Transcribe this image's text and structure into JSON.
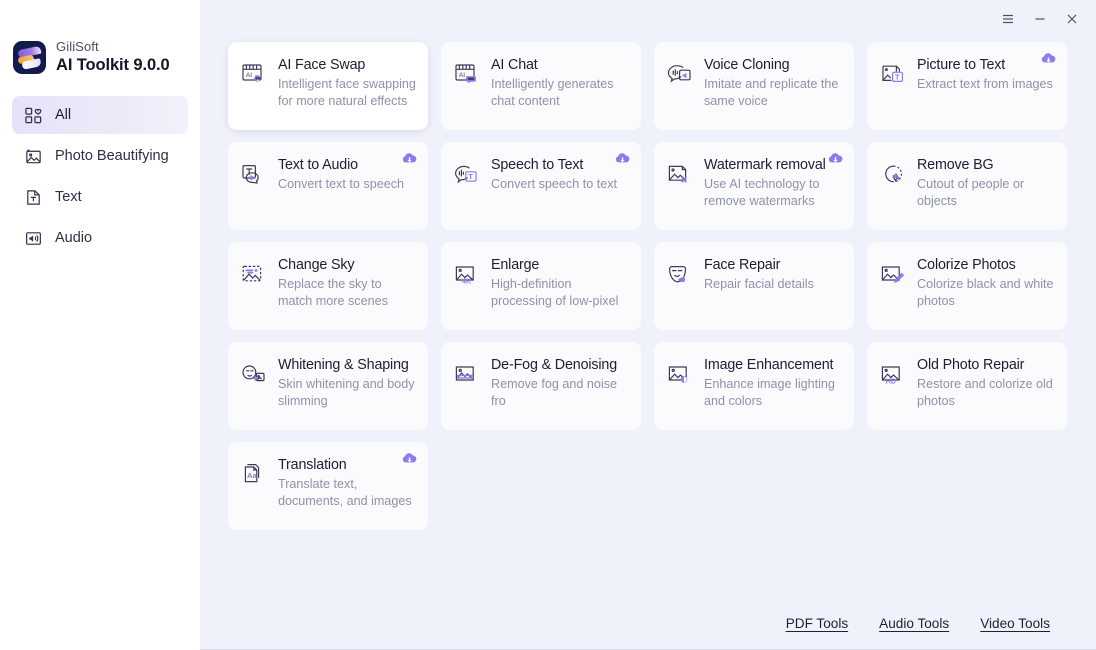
{
  "sidebar": {
    "brand": {
      "vendor": "GiliSoft",
      "product": "AI Toolkit 9.0.0",
      "logo_icon": "gilisoft-logo"
    },
    "items": [
      {
        "label": "All",
        "icon": "grid-heart-icon",
        "active": true
      },
      {
        "label": "Photo Beautifying",
        "icon": "photo-sparkle-icon",
        "active": false
      },
      {
        "label": "Text",
        "icon": "text-document-icon",
        "active": false
      },
      {
        "label": "Audio",
        "icon": "speaker-icon",
        "active": false
      }
    ]
  },
  "titlebar": {
    "buttons": [
      {
        "name": "menu-button",
        "icon": "hamburger-icon"
      },
      {
        "name": "minimize-button",
        "icon": "minimize-icon"
      },
      {
        "name": "close-button",
        "icon": "close-icon"
      }
    ]
  },
  "colors": {
    "accent": "#8b7bec",
    "main_background": "#f0f2fb",
    "card_background": "#fbfbfe",
    "sidebar_background": "#ffffff",
    "title_text": "#1c1e33",
    "desc_text": "#8e92a8",
    "logo_background": "#131a4f"
  },
  "cards": [
    {
      "title": "AI Face Swap",
      "desc": "Intelligent face swapping for more natural effects",
      "icon": "ai-face-swap-icon",
      "cloud": false,
      "hover": true
    },
    {
      "title": "AI Chat",
      "desc": "Intelligently generates chat content",
      "icon": "ai-chat-icon",
      "cloud": false,
      "hover": false
    },
    {
      "title": "Voice Cloning",
      "desc": "Imitate and replicate the same voice",
      "icon": "voice-cloning-icon",
      "cloud": false,
      "hover": false
    },
    {
      "title": "Picture to Text",
      "desc": "Extract text from images",
      "icon": "picture-to-text-icon",
      "cloud": true,
      "hover": false
    },
    {
      "title": "Text to Audio",
      "desc": "Convert text to speech",
      "icon": "text-to-audio-icon",
      "cloud": true,
      "hover": false
    },
    {
      "title": "Speech to Text",
      "desc": "Convert speech to text",
      "icon": "speech-to-text-icon",
      "cloud": true,
      "hover": false
    },
    {
      "title": "Watermark removal",
      "desc": "Use AI technology to remove watermarks",
      "icon": "watermark-removal-icon",
      "cloud": true,
      "hover": false
    },
    {
      "title": "Remove BG",
      "desc": "Cutout of people or objects",
      "icon": "remove-bg-icon",
      "cloud": false,
      "hover": false
    },
    {
      "title": "Change Sky",
      "desc": "Replace the sky to match more scenes",
      "icon": "change-sky-icon",
      "cloud": false,
      "hover": false
    },
    {
      "title": "Enlarge",
      "desc": "High-definition processing of low-pixel",
      "icon": "enlarge-4k-icon",
      "cloud": false,
      "hover": false
    },
    {
      "title": "Face Repair",
      "desc": "Repair facial details",
      "icon": "face-repair-icon",
      "cloud": false,
      "hover": false
    },
    {
      "title": "Colorize Photos",
      "desc": "Colorize black and white photos",
      "icon": "colorize-photos-icon",
      "cloud": false,
      "hover": false
    },
    {
      "title": "Whitening & Shaping",
      "desc": "Skin whitening and body slimming",
      "icon": "whitening-shaping-icon",
      "cloud": false,
      "hover": false
    },
    {
      "title": "De-Fog & Denoising",
      "desc": "Remove fog and noise fro",
      "icon": "defog-denoising-icon",
      "cloud": false,
      "hover": false
    },
    {
      "title": "Image Enhancement",
      "desc": "Enhance image lighting and colors",
      "icon": "image-enhancement-icon",
      "cloud": false,
      "hover": false
    },
    {
      "title": "Old Photo Repair",
      "desc": "Restore and colorize old photos",
      "icon": "old-photo-repair-icon",
      "cloud": false,
      "hover": false
    },
    {
      "title": "Translation",
      "desc": "Translate text, documents, and images",
      "icon": "translation-icon",
      "cloud": true,
      "hover": false
    }
  ],
  "footer": {
    "links": [
      {
        "label": "PDF Tools",
        "name": "pdf-tools-link"
      },
      {
        "label": "Audio Tools",
        "name": "audio-tools-link"
      },
      {
        "label": "Video Tools",
        "name": "video-tools-link"
      }
    ]
  }
}
